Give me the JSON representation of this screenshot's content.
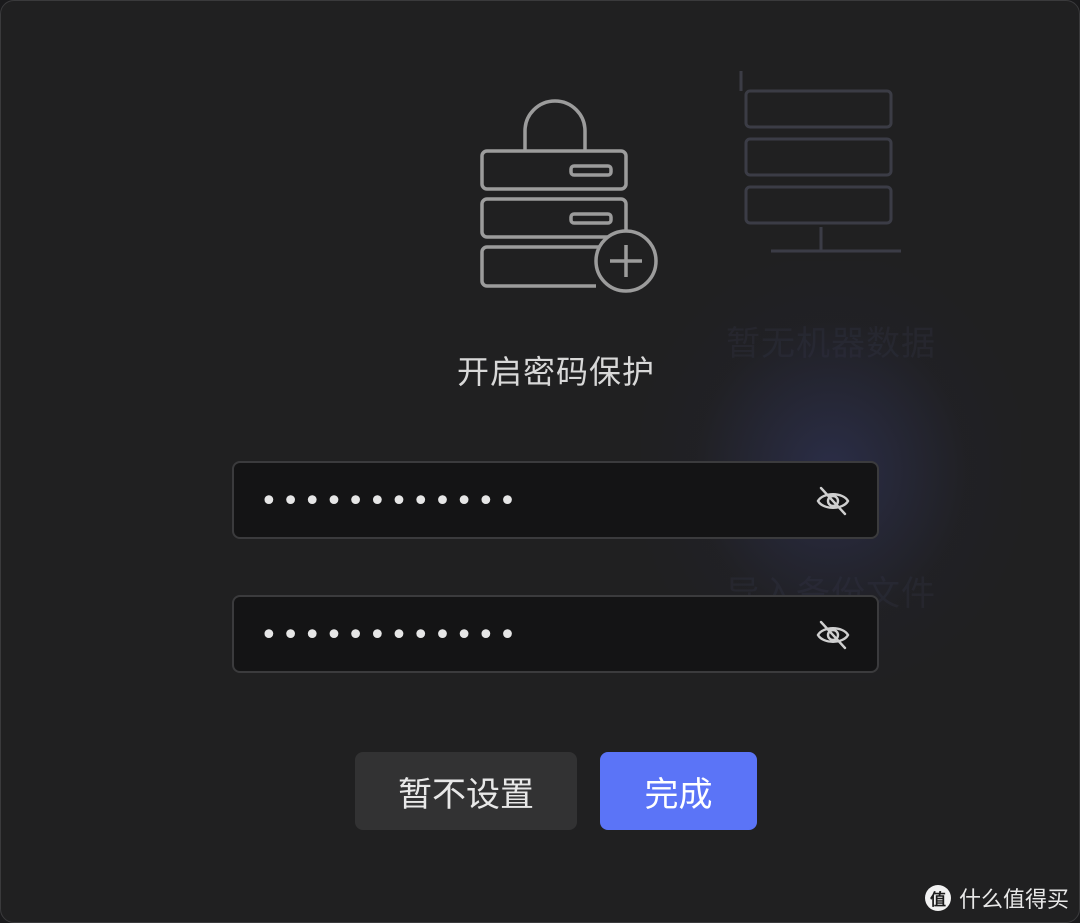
{
  "background_ghost": {
    "empty_label": "暂无机器数据",
    "import_label": "导入备份文件"
  },
  "dialog": {
    "icon": "lock-server-add-icon",
    "title": "开启密码保护"
  },
  "password_field": {
    "value": "••••••••••••",
    "visibility_icon": "eye-off-icon"
  },
  "confirm_field": {
    "value": "••••••••••••",
    "visibility_icon": "eye-off-icon"
  },
  "buttons": {
    "skip_label": "暂不设置",
    "done_label": "完成"
  },
  "watermark": {
    "logo": "值",
    "text": "什么值得买"
  },
  "colors": {
    "accent": "#5b74f7",
    "background": "#202021",
    "field_background": "#141415"
  }
}
